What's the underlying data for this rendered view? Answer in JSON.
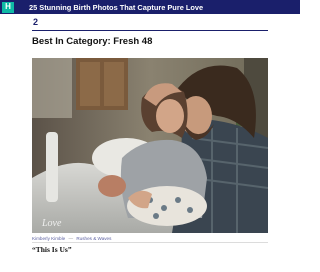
{
  "header": {
    "logo_glyph": "H",
    "title": "25 Stunning Birth Photos That Capture Pure Love",
    "bar_color": "#1a1f6b",
    "logo_color": "#0fb9a5"
  },
  "slide": {
    "number": "2",
    "title": "Best In Category: Fresh 48",
    "photo_watermark": "Love",
    "credit_photographer": "Kimberly Kimble",
    "credit_separator": "—",
    "credit_studio": "Rushes & Waves",
    "caption": "“This Is Us”"
  }
}
